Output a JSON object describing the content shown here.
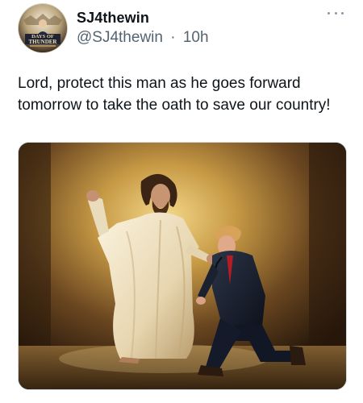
{
  "author": {
    "display_name": "SJ4thewin",
    "handle": "@SJ4thewin",
    "separator": "·",
    "time": "10h",
    "avatar_icon": "days-of-thunder-avatar",
    "avatar_text_top": "DAYS OF",
    "avatar_text_bottom": "THUNDER"
  },
  "menu": {
    "icon": "more-horizontal-icon"
  },
  "tweet": {
    "text": "Lord, protect this man as he goes forward tomorrow to take the oath to save our country!"
  },
  "media": {
    "icon": "attached-image"
  },
  "colors": {
    "text": "#0f1419",
    "secondary": "#536471",
    "border": "#cfd9de"
  }
}
